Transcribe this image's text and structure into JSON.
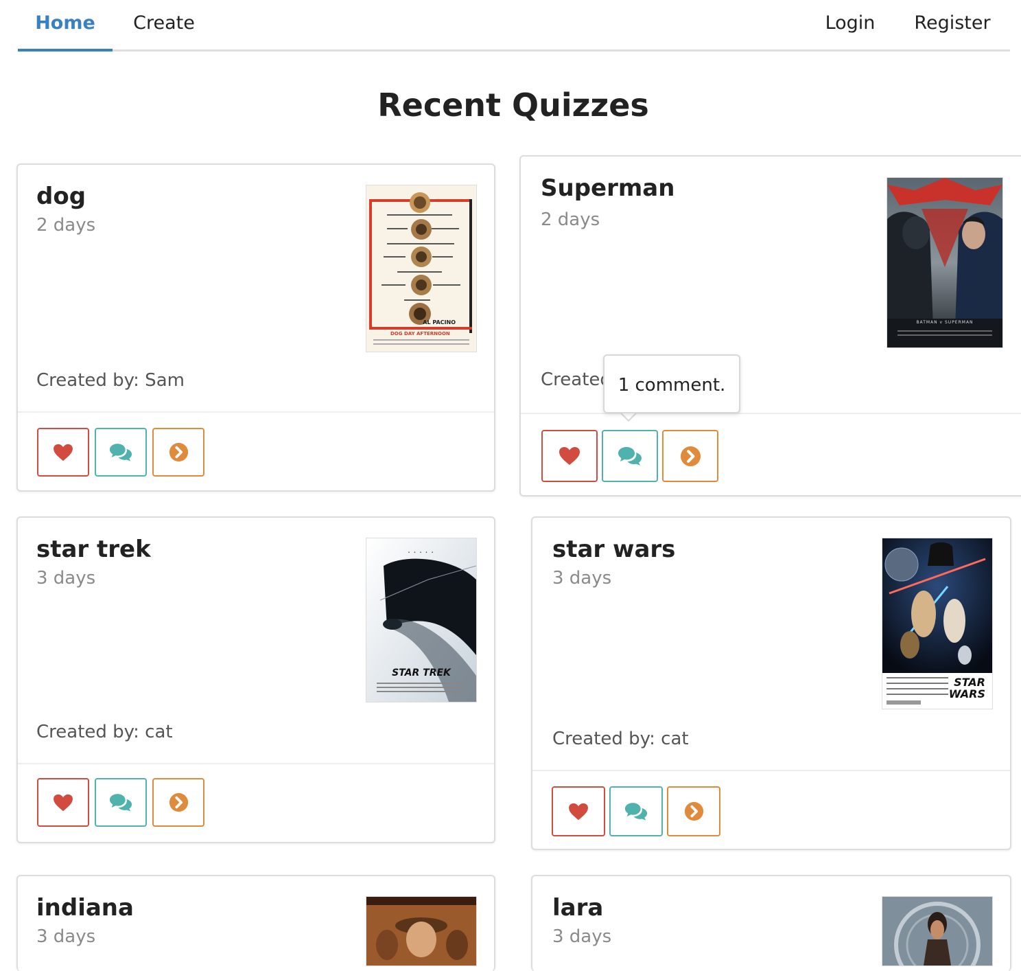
{
  "nav": {
    "home": "Home",
    "create": "Create",
    "login": "Login",
    "register": "Register"
  },
  "page": {
    "title": "Recent Quizzes"
  },
  "cards": [
    {
      "title": "dog",
      "age": "2 days",
      "creator": "Created by: Sam",
      "poster": "Dog Day Afternoon poster"
    },
    {
      "title": "Superman",
      "age": "2 days",
      "creator": "Created by: cat",
      "creator_visible": "Create",
      "poster": "Batman v Superman poster"
    },
    {
      "title": "star trek",
      "age": "3 days",
      "creator": "Created by: cat",
      "poster": "Star Trek poster"
    },
    {
      "title": "star wars",
      "age": "3 days",
      "creator": "Created by: cat",
      "poster": "Star Wars poster"
    },
    {
      "title": "indiana",
      "age": "3 days",
      "poster": "Indiana Jones poster"
    },
    {
      "title": "lara",
      "age": "3 days",
      "poster": "Tomb Raider poster"
    }
  ],
  "tooltip": {
    "text": "1 comment."
  },
  "icons": {
    "like": "heart-icon",
    "comment": "comments-icon",
    "go": "chevron-circle-right-icon"
  },
  "colors": {
    "accent": "#3a81c4",
    "like": "#d14b3f",
    "comment": "#4fb2ad",
    "go": "#e08a3c"
  },
  "poster_text": {
    "dog_day": "DOG DAY AFTERNOON",
    "dog_day_actor": "AL PACINO",
    "batman": "BATMAN v SUPERMAN",
    "star_trek": "STAR TREK",
    "star_wars_1": "STAR",
    "star_wars_2": "WARS"
  }
}
